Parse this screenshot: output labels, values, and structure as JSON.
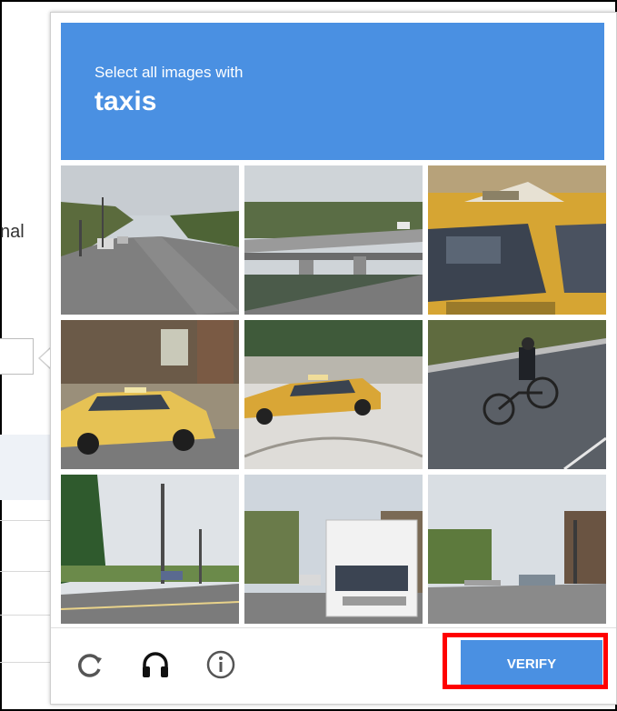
{
  "background_page": {
    "partial_text": "nal"
  },
  "captcha": {
    "instruction": "Select all images with",
    "target": "taxis",
    "tiles": [
      {
        "subject": "street-with-cars"
      },
      {
        "subject": "highway-overpass"
      },
      {
        "subject": "taxi-closeup"
      },
      {
        "subject": "yellow-taxi-parked"
      },
      {
        "subject": "yellow-taxi-turning"
      },
      {
        "subject": "cyclist-on-road"
      },
      {
        "subject": "road-with-utility-poles"
      },
      {
        "subject": "white-truck-on-street"
      },
      {
        "subject": "suburban-street"
      }
    ],
    "footer": {
      "reload_icon": "reload-icon",
      "audio_icon": "headphones-icon",
      "info_icon": "info-icon",
      "verify_label": "VERIFY"
    }
  },
  "colors": {
    "header_blue": "#4a90e2",
    "highlight_red": "#ff0000",
    "icon_gray": "#555555"
  }
}
